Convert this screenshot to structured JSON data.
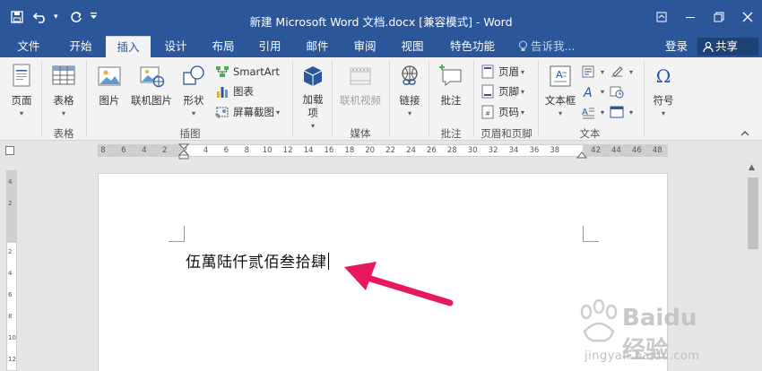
{
  "window": {
    "title": "新建 Microsoft Word 文档.docx [兼容模式] - Word"
  },
  "qat": {
    "save_icon": "save-icon",
    "undo_icon": "undo-icon",
    "redo_icon": "redo-icon"
  },
  "tabs": [
    {
      "label": "文件"
    },
    {
      "label": "开始"
    },
    {
      "label": "插入",
      "active": true
    },
    {
      "label": "设计"
    },
    {
      "label": "布局"
    },
    {
      "label": "引用"
    },
    {
      "label": "邮件"
    },
    {
      "label": "审阅"
    },
    {
      "label": "视图"
    },
    {
      "label": "特色功能"
    }
  ],
  "tellme": "告诉我...",
  "login": "登录",
  "share": "共享",
  "ribbon": {
    "pages": {
      "label": "页面",
      "group": ""
    },
    "table": {
      "label": "表格",
      "group": "表格"
    },
    "illustrations": {
      "group": "插图",
      "picture": "图片",
      "online_picture": "联机图片",
      "shapes": "形状",
      "smartart": "SmartArt",
      "chart": "图表",
      "screenshot": "屏幕截图"
    },
    "addins": {
      "label": "加载项"
    },
    "media": {
      "group": "媒体",
      "online_video": "联机视频"
    },
    "links": {
      "label": "链接"
    },
    "comments": {
      "group": "批注",
      "comment": "批注"
    },
    "header_footer": {
      "group": "页眉和页脚",
      "header": "页眉",
      "footer": "页脚",
      "page_number": "页码"
    },
    "text": {
      "group": "文本",
      "textbox": "文本框"
    },
    "symbols": {
      "label": "符号"
    }
  },
  "ruler": {
    "numbers": [
      "8",
      "6",
      "4",
      "2",
      "2",
      "4",
      "6",
      "8",
      "10",
      "12",
      "14",
      "16",
      "18",
      "20",
      "22",
      "24",
      "26",
      "28",
      "30",
      "32",
      "34",
      "36",
      "38",
      "42",
      "44",
      "46",
      "48"
    ]
  },
  "vruler": {
    "numbers": [
      "4",
      "2",
      "2",
      "4",
      "6",
      "8",
      "10",
      "12"
    ]
  },
  "document": {
    "text": "伍萬陆仟贰佰叁拾肆"
  },
  "watermark": {
    "brand": "Baidu 经验",
    "url": "jingyan.baidu.com"
  },
  "colors": {
    "accent": "#2b579a",
    "annotation": "#e8185e"
  }
}
